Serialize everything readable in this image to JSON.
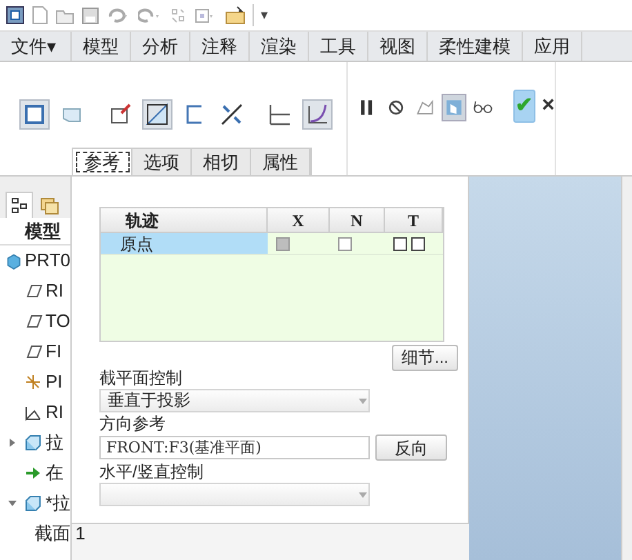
{
  "quick_access_toolbar": {
    "overflow": "▾"
  },
  "menu_tabs": [
    {
      "label": "文件▾",
      "selected": false
    },
    {
      "label": "模型",
      "selected": false
    },
    {
      "label": "分析",
      "selected": false
    },
    {
      "label": "注释",
      "selected": false
    },
    {
      "label": "渲染",
      "selected": false
    },
    {
      "label": "工具",
      "selected": false
    },
    {
      "label": "视图",
      "selected": false
    },
    {
      "label": "柔性建模",
      "selected": false
    },
    {
      "label": "应用",
      "selected": false
    }
  ],
  "ribbon_tools": [
    {
      "kind": "solid",
      "selected": true
    },
    {
      "kind": "surface",
      "selected": false
    },
    {
      "kind": "sketch",
      "selected": false
    },
    {
      "kind": "remove",
      "selected": true
    },
    {
      "kind": "thicken",
      "selected": false
    },
    {
      "kind": "flip",
      "selected": false
    },
    {
      "kind": "normal",
      "selected": false
    },
    {
      "kind": "curve",
      "selected": true
    }
  ],
  "ribbon_controls": [
    {
      "kind": "pause",
      "selected": false
    },
    {
      "kind": "nopreview",
      "selected": false
    },
    {
      "kind": "geometry",
      "selected": false
    },
    {
      "kind": "preview",
      "selected": true
    },
    {
      "kind": "glasses",
      "selected": false
    }
  ],
  "ok_button": {
    "label": "✔"
  },
  "cancel_button": {
    "label": "×"
  },
  "panel_tabs": [
    {
      "label": "参考",
      "selected": true
    },
    {
      "label": "选项",
      "selected": false
    },
    {
      "label": "相切",
      "selected": false
    },
    {
      "label": "属性",
      "selected": false
    }
  ],
  "model_tree": {
    "title": "模型",
    "items": [
      {
        "label": "PRT0",
        "kind": "part",
        "children": [
          {
            "label": "RI",
            "kind": "plane"
          },
          {
            "label": "TO",
            "kind": "plane"
          },
          {
            "label": "FI",
            "kind": "plane"
          },
          {
            "label": "PI",
            "kind": "csys"
          },
          {
            "label": "RI",
            "kind": "axis"
          },
          {
            "label": "拉",
            "kind": "feature",
            "expanded": false
          },
          {
            "label": "在",
            "kind": "insert"
          },
          {
            "label": "*拉",
            "kind": "feature",
            "expanded": true,
            "children": [
              {
                "label": "截面 1",
                "kind": "sketch"
              }
            ]
          }
        ]
      }
    ]
  },
  "trajectory_table": {
    "columns": [
      "轨迹",
      "X",
      "N",
      "T"
    ],
    "rows": [
      {
        "name": "原点",
        "selected": true,
        "x": {
          "checked": false,
          "disabled": true
        },
        "n": {
          "checked": false
        },
        "t": [
          {
            "checked": false
          },
          {
            "checked": false
          }
        ]
      }
    ]
  },
  "details_button": "细节...",
  "section_control": {
    "label": "截平面控制",
    "value": "垂直于投影"
  },
  "direction_reference": {
    "label": "方向参考",
    "value": "FRONT:F3(基准平面)",
    "button": "反向"
  },
  "horizontal_vertical_control": {
    "label": "水平/竖直控制"
  }
}
